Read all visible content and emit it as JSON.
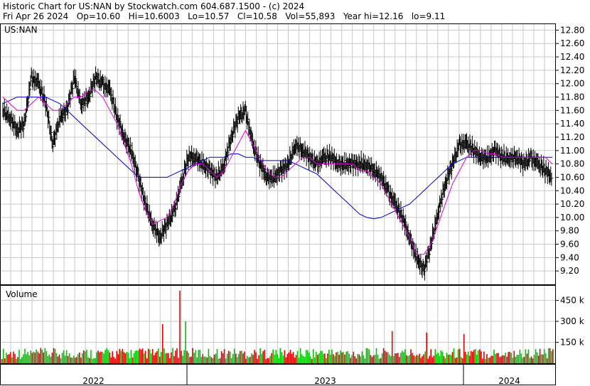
{
  "header": {
    "line1": "Historic Chart for US:NAN by Stockwatch.com 604.687.1500 - (c) 2024",
    "line2": "Fri Apr 26 2024   Op=10.60   Hi=10.6003   Lo=10.57   Cl=10.58   Vol=55,893   Year hi=12.16   lo=9.11"
  },
  "chart_data": [
    {
      "type": "candlestick",
      "title": "US:NAN",
      "ylim": [
        9.0,
        12.9
      ],
      "y_ticks": [
        "12.80",
        "12.60",
        "12.40",
        "12.20",
        "12.00",
        "11.80",
        "11.60",
        "11.40",
        "11.20",
        "11.00",
        "10.80",
        "10.60",
        "10.40",
        "10.20",
        "10.00",
        "9.80",
        "9.60",
        "9.40",
        "9.20"
      ],
      "x_ticks": [
        "2022",
        "2023",
        "2024"
      ],
      "grid": true,
      "colors": {
        "price": "#000000",
        "ma_short": "#e000e0",
        "ma_long": "#0000cc",
        "grid": "#c8c8c8"
      },
      "series": [
        {
          "name": "",
          "kind": "price_close",
          "values": [
            11.6,
            11.5,
            11.3,
            11.4,
            12.1,
            12.0,
            11.7,
            11.1,
            11.5,
            11.6,
            12.1,
            11.7,
            11.8,
            12.1,
            12.0,
            11.9,
            11.5,
            11.2,
            11.0,
            10.6,
            10.2,
            9.9,
            9.7,
            9.9,
            10.1,
            10.5,
            10.9,
            10.9,
            10.8,
            10.7,
            10.6,
            10.8,
            11.2,
            11.5,
            11.6,
            11.1,
            10.8,
            10.6,
            10.6,
            10.7,
            10.8,
            11.1,
            11.0,
            10.9,
            10.8,
            10.9,
            10.9,
            10.8,
            10.8,
            10.8,
            10.8,
            10.8,
            10.7,
            10.6,
            10.4,
            10.2,
            10.0,
            9.7,
            9.4,
            9.2,
            9.6,
            10.1,
            10.5,
            10.8,
            11.1,
            11.1,
            11.0,
            10.9,
            10.9,
            11.0,
            10.9,
            10.9,
            10.9,
            10.8,
            10.9,
            10.8,
            10.7,
            10.6
          ]
        },
        {
          "name": "",
          "kind": "moving_average_short",
          "values": [
            11.8,
            11.7,
            11.6,
            11.6,
            11.7,
            11.8,
            11.7,
            11.6,
            11.6,
            11.7,
            11.8,
            11.8,
            11.9,
            11.9,
            11.8,
            11.6,
            11.4,
            11.1,
            10.8,
            10.4,
            10.1,
            9.9,
            9.95,
            10.0,
            10.2,
            10.5,
            10.7,
            10.8,
            10.8,
            10.7,
            10.6,
            10.7,
            10.9,
            11.1,
            11.3,
            11.1,
            10.9,
            10.7,
            10.6,
            10.6,
            10.7,
            10.8,
            10.9,
            10.9,
            10.8,
            10.8,
            10.8,
            10.8,
            10.8,
            10.8,
            10.7,
            10.7,
            10.6,
            10.5,
            10.3,
            10.1,
            9.9,
            9.7,
            9.45,
            9.45,
            9.6,
            9.9,
            10.2,
            10.5,
            10.7,
            10.9,
            11.0,
            11.0,
            10.95,
            10.95,
            10.9,
            10.9,
            10.9,
            10.9,
            10.9,
            10.9,
            10.9,
            10.8
          ]
        },
        {
          "name": "",
          "kind": "moving_average_long",
          "values": [
            11.7,
            11.75,
            11.8,
            11.8,
            11.8,
            11.8,
            11.8,
            11.75,
            11.7,
            11.6,
            11.5,
            11.4,
            11.3,
            11.2,
            11.1,
            11.0,
            10.9,
            10.8,
            10.7,
            10.6,
            10.6,
            10.6,
            10.6,
            10.6,
            10.65,
            10.7,
            10.75,
            10.8,
            10.85,
            10.9,
            10.9,
            10.9,
            10.95,
            10.95,
            10.9,
            10.9,
            10.85,
            10.85,
            10.85,
            10.85,
            10.85,
            10.8,
            10.75,
            10.7,
            10.65,
            10.55,
            10.45,
            10.35,
            10.25,
            10.15,
            10.05,
            10.0,
            9.98,
            10.0,
            10.05,
            10.1,
            10.15,
            10.2,
            10.3,
            10.4,
            10.5,
            10.6,
            10.7,
            10.8,
            10.85,
            10.9,
            10.9,
            10.9,
            10.9,
            10.9,
            10.9,
            10.9,
            10.9,
            10.9,
            10.9,
            10.9,
            10.9,
            10.9
          ]
        }
      ]
    },
    {
      "type": "bar",
      "title": "Volume",
      "ylim": [
        0,
        560
      ],
      "y_ticks": [
        "450 k",
        "300 k",
        "150 k"
      ],
      "colors": {
        "up": "#00c000",
        "down": "#e00000"
      },
      "peak_values_k": [
        520,
        280,
        300,
        230,
        220,
        210
      ],
      "typical_range_k": [
        30,
        110
      ]
    }
  ]
}
